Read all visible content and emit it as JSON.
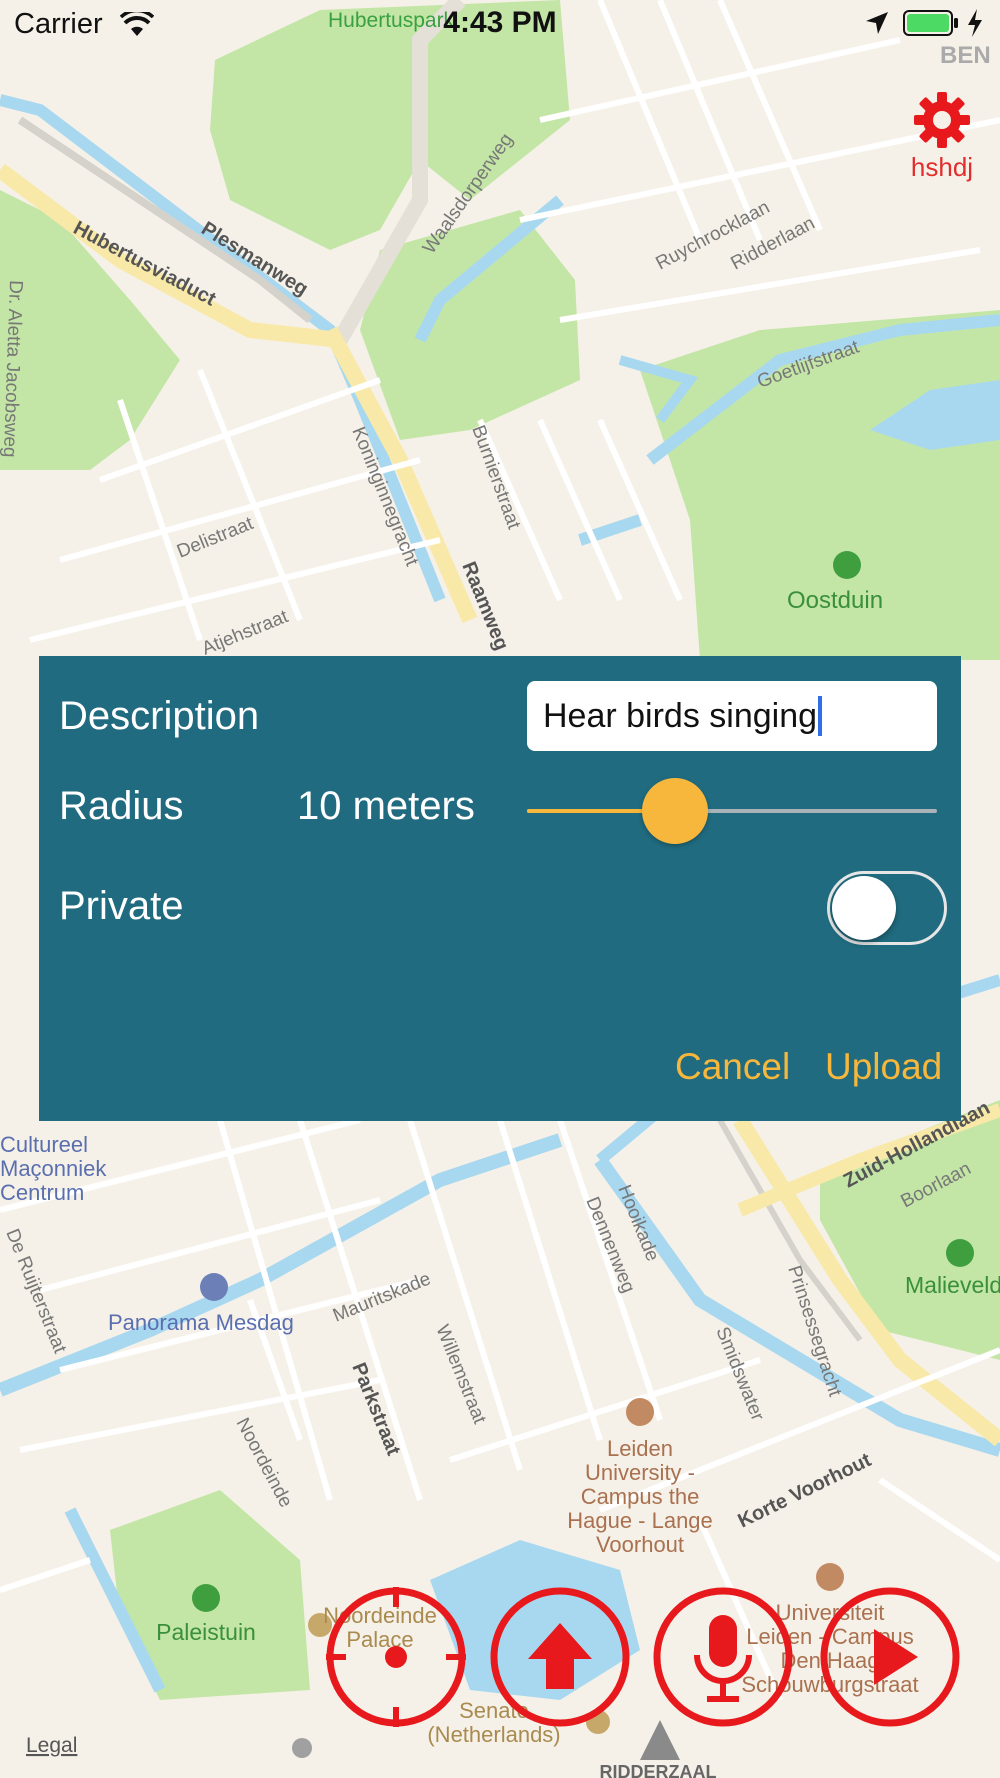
{
  "status_bar": {
    "carrier": "Carrier",
    "time": "4:43 PM"
  },
  "settings": {
    "username": "hshdj",
    "icon": "gear-icon"
  },
  "dialog": {
    "description_label": "Description",
    "description_value": "Hear birds singing",
    "radius_label": "Radius",
    "radius_value": "10 meters",
    "radius_slider_fraction": 0.36,
    "private_label": "Private",
    "private_on": false,
    "cancel_label": "Cancel",
    "upload_label": "Upload"
  },
  "actions": {
    "locate_icon": "crosshair-icon",
    "upload_icon": "up-arrow-icon",
    "record_icon": "microphone-icon",
    "play_icon": "play-icon"
  },
  "map_labels": {
    "hubertuspark": "Hubertuspark",
    "hubertusviaduct": "Hubertusviaduct",
    "plesmanweg": "Plesmanweg",
    "waalsdorperweg": "Waalsdorperweg",
    "ruychrocklaan": "Ruychrocklaan",
    "ridderlaan": "Ridderlaan",
    "goetlijfstraat": "Goetlijfstraat",
    "dr_aletta": "Dr. Aletta Jacobsweg",
    "koninginnegracht": "Koninginnegracht",
    "burnierstraat": "Burnierstraat",
    "raamweg": "Raamweg",
    "delistraat": "Delistraat",
    "atjehstraat": "Atjehstraat",
    "oostduin": "Oostduin",
    "cultureel_1": "Cultureel",
    "cultureel_2": "Maçonniek",
    "cultureel_3": "Centrum",
    "zuid_hollandlaan": "Zuid-Hollandlaan",
    "boorlaan": "Boorlaan",
    "malieveld": "Malieveld",
    "de_ruijterstraat": "De Ruijterstraat",
    "panorama_mesdag": "Panorama Mesdag",
    "mauritskade": "Mauritskade",
    "dennenweg": "Dennenweg",
    "hooikade": "Hooikade",
    "prinsessegracht": "Prinsessegracht",
    "smidswater": "Smidswater",
    "willemstraat": "Willemstraat",
    "parkstraat": "Parkstraat",
    "noordeinde": "Noordeinde",
    "leiden_1": "Leiden",
    "leiden_2": "University -",
    "leiden_3": "Campus the",
    "leiden_4": "Hague - Lange",
    "leiden_5": "Voorhout",
    "korte_voorhout": "Korte Voorhout",
    "paleistuin": "Paleistuin",
    "noordeinde_palace_1": "Noordeinde",
    "noordeinde_palace_2": "Palace",
    "universiteit_1": "Universiteit",
    "universiteit_2": "Leiden - Campus",
    "universiteit_3": "Den Haag",
    "universiteit_4": "Schouwburgstraat",
    "senate_1": "Senate",
    "senate_2": "(Netherlands)",
    "ridderzaal": "RIDDERZAAL",
    "legal": "Legal",
    "ben": "BEN"
  },
  "colors": {
    "dialog_bg": "#206b7f",
    "accent": "#f6b73c",
    "action_red": "#e8191c",
    "park_green": "#c3e6a6",
    "water_blue": "#a8d8f0"
  }
}
